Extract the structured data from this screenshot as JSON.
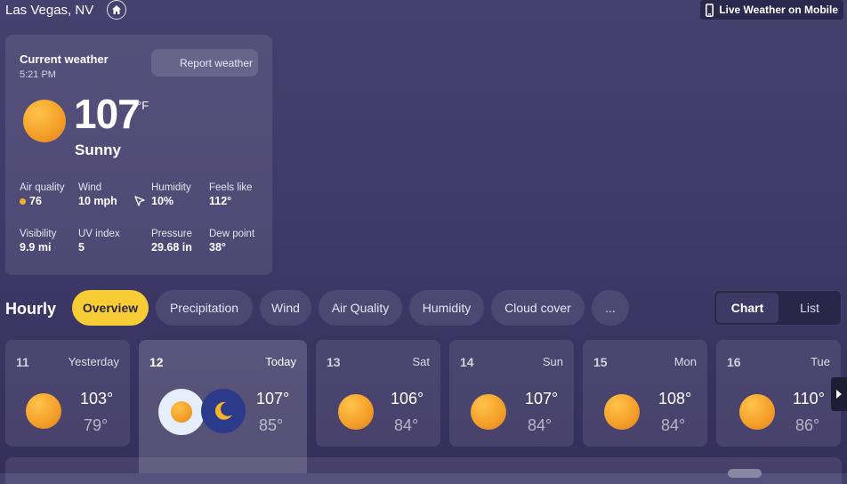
{
  "header": {
    "location": "Las Vegas, NV",
    "home_icon": "home-icon",
    "live_mobile_label": "Live Weather on Mobile",
    "phone_icon": "phone-icon"
  },
  "current": {
    "title": "Current weather",
    "time": "5:21 PM",
    "report_label": "Report weather",
    "temperature": "107",
    "unit": "°F",
    "condition": "Sunny",
    "condition_icon": "sun-icon",
    "stats": [
      {
        "label": "Air quality",
        "value": "76"
      },
      {
        "label": "Wind",
        "value": "10 mph"
      },
      {
        "label": "Humidity",
        "value": "10%"
      },
      {
        "label": "Feels like",
        "value": "112°"
      },
      {
        "label": "Visibility",
        "value": "9.9 mi"
      },
      {
        "label": "UV index",
        "value": "5"
      },
      {
        "label": "Pressure",
        "value": "29.68 in"
      },
      {
        "label": "Dew point",
        "value": "38°"
      }
    ],
    "aq_color": "#f2b12a"
  },
  "hourly": {
    "label": "Hourly",
    "tabs": [
      "Overview",
      "Precipitation",
      "Wind",
      "Air Quality",
      "Humidity",
      "Cloud cover",
      "..."
    ],
    "active_tab": "Overview",
    "view_chart": "Chart",
    "view_list": "List",
    "active_view": "Chart"
  },
  "days": [
    {
      "num": "11",
      "name": "Yesterday",
      "high": "103°",
      "low": "79°"
    },
    {
      "num": "12",
      "name": "Today",
      "high": "107°",
      "low": "85°"
    },
    {
      "num": "13",
      "name": "Sat",
      "high": "106°",
      "low": "84°"
    },
    {
      "num": "14",
      "name": "Sun",
      "high": "107°",
      "low": "84°"
    },
    {
      "num": "15",
      "name": "Mon",
      "high": "108°",
      "low": "84°"
    },
    {
      "num": "16",
      "name": "Tue",
      "high": "110°",
      "low": "86°"
    }
  ],
  "colors": {
    "accent": "#f7cd35",
    "sun": "#f5a12a",
    "moon_bg": "#2c3a8c",
    "moon": "#f5b52a"
  }
}
